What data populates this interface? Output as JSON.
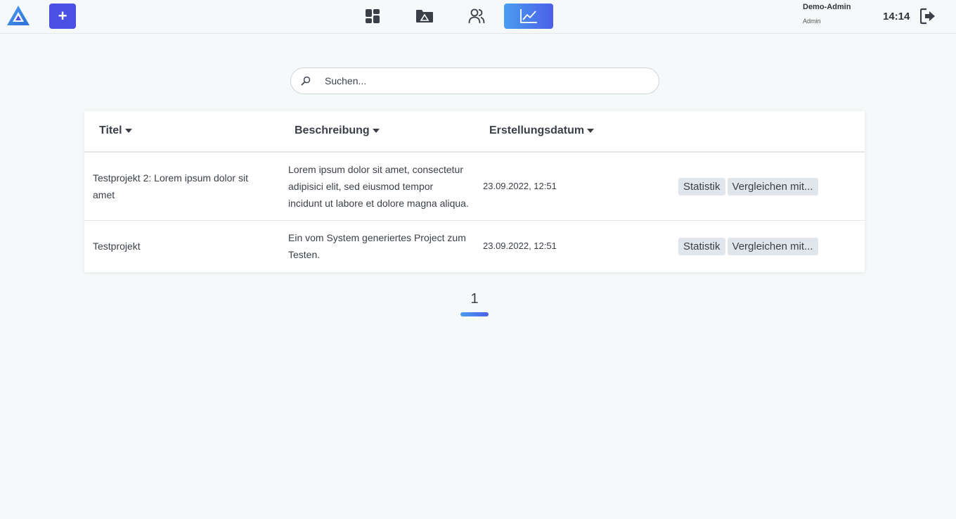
{
  "header": {
    "add_label": "+",
    "user_name": "Demo-Admin",
    "user_role": "Admin",
    "clock": "14:14",
    "accent": "#4b4fe3",
    "nav": [
      {
        "name": "dashboard-icon",
        "active": false
      },
      {
        "name": "projects-folder-icon",
        "active": false
      },
      {
        "name": "users-icon",
        "active": false
      },
      {
        "name": "statistics-chart-icon",
        "active": true
      }
    ]
  },
  "search": {
    "placeholder": "Suchen...",
    "value": ""
  },
  "table": {
    "columns": [
      {
        "label": "Titel"
      },
      {
        "label": "Beschreibung"
      },
      {
        "label": "Erstellungsdatum"
      }
    ],
    "rows": [
      {
        "title": "Testprojekt 2: Lorem ipsum dolor sit amet",
        "description": "Lorem ipsum dolor sit amet, consectetur adipisici elit, sed eiusmod tempor incidunt ut labore et dolore magna aliqua.",
        "date": "23.09.2022, 12:51",
        "stat_label": "Statistik",
        "compare_label": "Vergleichen mit..."
      },
      {
        "title": "Testprojekt",
        "description": "Ein vom System generiertes Project zum Testen.",
        "date": "23.09.2022, 12:51",
        "stat_label": "Statistik",
        "compare_label": "Vergleichen mit..."
      }
    ]
  },
  "pagination": {
    "current": "1"
  }
}
